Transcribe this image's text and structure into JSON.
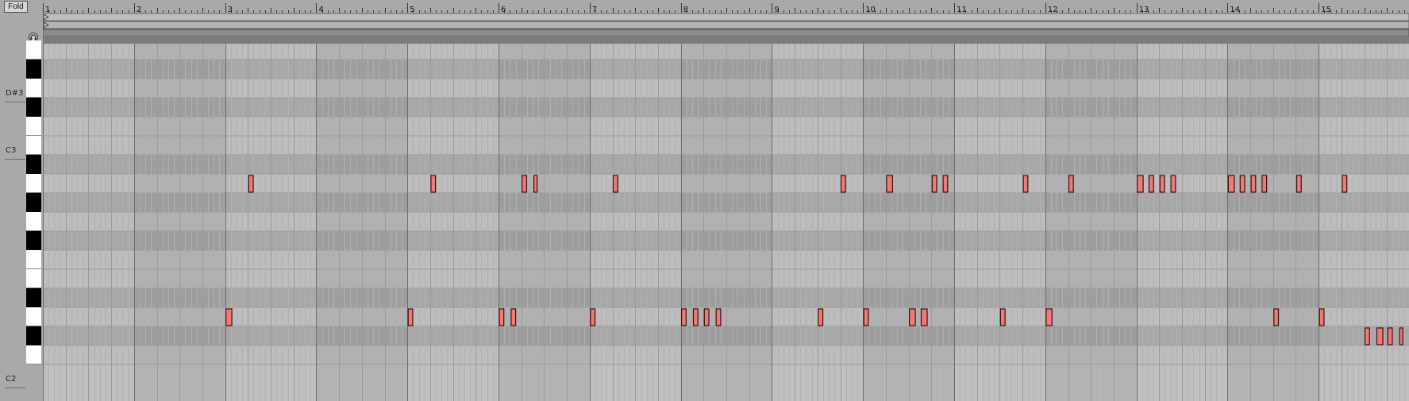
{
  "toolbar": {
    "fold_label": "Fold"
  },
  "icons": {
    "headphone": "headphone-icon",
    "fold_arrow": "triangle-right-icon"
  },
  "key_labels": [
    {
      "name": "D#3",
      "row": 2
    },
    {
      "name": "C3",
      "row": 5
    },
    {
      "name": "C2",
      "row": 17
    }
  ],
  "ruler": {
    "bar_numbers": [
      "1",
      "2",
      "3",
      "4",
      "5",
      "6",
      "7",
      "8",
      "9",
      "10",
      "11",
      "12",
      "13",
      "14",
      "15"
    ]
  },
  "piano_roll": {
    "total_bars": 15,
    "top_pitch": "E3",
    "pitch_rows": [
      "E3",
      "D#3",
      "D3",
      "C#3",
      "C3",
      "B2",
      "A#2",
      "A2",
      "G#2",
      "G2",
      "F#2",
      "F2",
      "E2",
      "D#2",
      "D2",
      "C#2",
      "C2"
    ],
    "notes": [
      {
        "pitch": "A2",
        "start": 3.25,
        "dur": 0.05
      },
      {
        "pitch": "A2",
        "start": 5.25,
        "dur": 0.05
      },
      {
        "pitch": "A2",
        "start": 6.25,
        "dur": 0.05
      },
      {
        "pitch": "A2",
        "start": 6.38,
        "dur": 0.025
      },
      {
        "pitch": "A2",
        "start": 7.25,
        "dur": 0.05
      },
      {
        "pitch": "A2",
        "start": 9.75,
        "dur": 0.05
      },
      {
        "pitch": "A2",
        "start": 10.25,
        "dur": 0.065
      },
      {
        "pitch": "A2",
        "start": 10.75,
        "dur": 0.05
      },
      {
        "pitch": "A2",
        "start": 10.87,
        "dur": 0.05
      },
      {
        "pitch": "A2",
        "start": 11.75,
        "dur": 0.05
      },
      {
        "pitch": "A2",
        "start": 12.25,
        "dur": 0.05
      },
      {
        "pitch": "A2",
        "start": 13.0,
        "dur": 0.065
      },
      {
        "pitch": "A2",
        "start": 13.13,
        "dur": 0.05
      },
      {
        "pitch": "A2",
        "start": 13.25,
        "dur": 0.05
      },
      {
        "pitch": "A2",
        "start": 13.37,
        "dur": 0.05
      },
      {
        "pitch": "A2",
        "start": 14.0,
        "dur": 0.065
      },
      {
        "pitch": "A2",
        "start": 14.13,
        "dur": 0.05
      },
      {
        "pitch": "A2",
        "start": 14.25,
        "dur": 0.05
      },
      {
        "pitch": "A2",
        "start": 14.37,
        "dur": 0.05
      },
      {
        "pitch": "A2",
        "start": 14.75,
        "dur": 0.05
      },
      {
        "pitch": "A2",
        "start": 15.25,
        "dur": 0.05
      },
      {
        "pitch": "D2",
        "start": 3.0,
        "dur": 0.065
      },
      {
        "pitch": "D2",
        "start": 5.0,
        "dur": 0.05
      },
      {
        "pitch": "D2",
        "start": 6.0,
        "dur": 0.05
      },
      {
        "pitch": "D2",
        "start": 6.13,
        "dur": 0.05
      },
      {
        "pitch": "D2",
        "start": 7.0,
        "dur": 0.05
      },
      {
        "pitch": "D2",
        "start": 8.0,
        "dur": 0.05
      },
      {
        "pitch": "D2",
        "start": 8.13,
        "dur": 0.05
      },
      {
        "pitch": "D2",
        "start": 8.25,
        "dur": 0.05
      },
      {
        "pitch": "D2",
        "start": 8.38,
        "dur": 0.05
      },
      {
        "pitch": "D2",
        "start": 9.5,
        "dur": 0.05
      },
      {
        "pitch": "D2",
        "start": 10.0,
        "dur": 0.05
      },
      {
        "pitch": "D2",
        "start": 10.5,
        "dur": 0.065
      },
      {
        "pitch": "D2",
        "start": 10.63,
        "dur": 0.065
      },
      {
        "pitch": "D2",
        "start": 11.5,
        "dur": 0.05
      },
      {
        "pitch": "D2",
        "start": 12.0,
        "dur": 0.065
      },
      {
        "pitch": "D2",
        "start": 14.5,
        "dur": 0.05
      },
      {
        "pitch": "D2",
        "start": 15.0,
        "dur": 0.05
      },
      {
        "pitch": "C#2",
        "start": 15.5,
        "dur": 0.05
      },
      {
        "pitch": "C#2",
        "start": 15.63,
        "dur": 0.065
      },
      {
        "pitch": "C#2",
        "start": 15.75,
        "dur": 0.05
      },
      {
        "pitch": "C#2",
        "start": 15.88,
        "dur": 0.035
      }
    ]
  },
  "colors": {
    "note_fill": "#f07a74",
    "note_border": "#3a1010",
    "row_white": "#bcbcbc",
    "row_black": "#a3a3a3",
    "bar_alt_dark": "#b2b2b2",
    "bar_line": "#6c6c6c",
    "beat_line": "#9a9a9a",
    "sub_line": "#b0b0b0"
  }
}
